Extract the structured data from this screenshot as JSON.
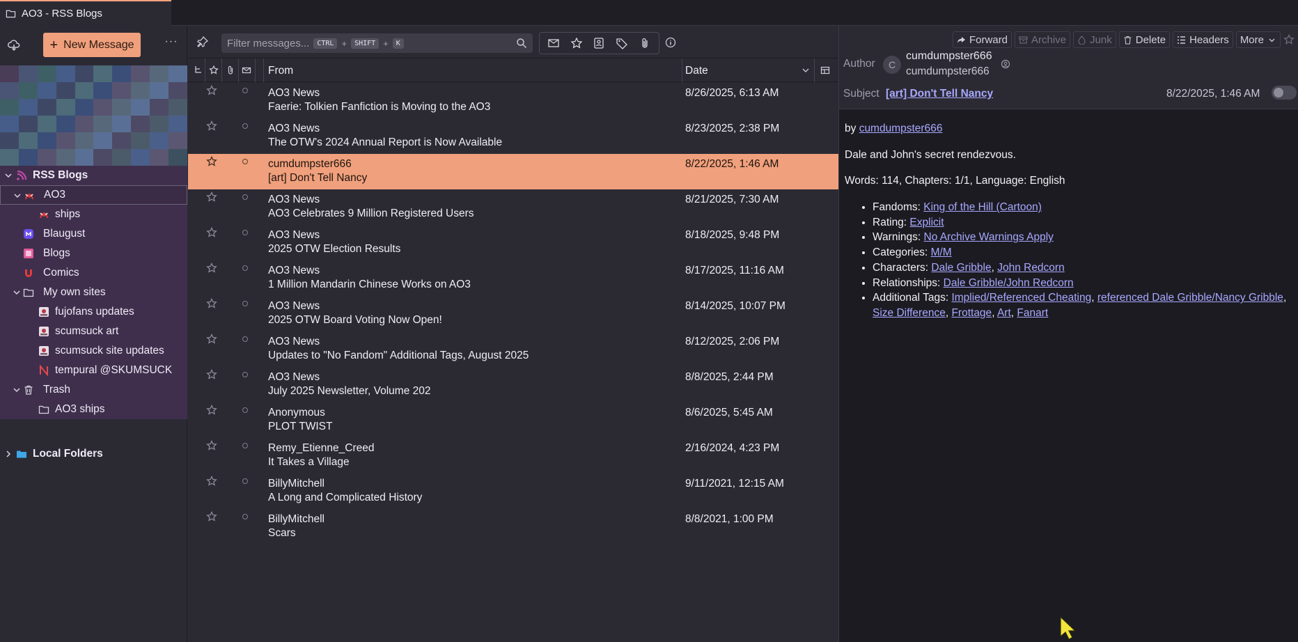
{
  "window": {
    "tab_title": "AO3 - RSS Blogs"
  },
  "sidebar": {
    "new_message": "New Message",
    "more": "···",
    "folders": [
      {
        "label": "RSS Blogs",
        "icon": "rss-icon",
        "bold": true,
        "twisty": "down",
        "indent": 0
      },
      {
        "label": "AO3",
        "icon": "ao3-feed-icon",
        "bold": false,
        "twisty": "down",
        "indent": 1,
        "selected": true
      },
      {
        "label": "ships",
        "icon": "ao3-feed-icon",
        "bold": false,
        "twisty": "",
        "indent": 2
      },
      {
        "label": "Blaugust",
        "icon": "mastodon-feed-icon",
        "bold": false,
        "twisty": "",
        "indent": 1
      },
      {
        "label": "Blogs",
        "icon": "blogs-feed-icon",
        "bold": false,
        "twisty": "",
        "indent": 1
      },
      {
        "label": "Comics",
        "icon": "comics-feed-icon",
        "bold": false,
        "twisty": "",
        "indent": 1
      },
      {
        "label": "My own sites",
        "icon": "folder-icon",
        "bold": false,
        "twisty": "down",
        "indent": 1
      },
      {
        "label": "fujofans updates",
        "icon": "site-feed-icon",
        "bold": false,
        "twisty": "",
        "indent": 2
      },
      {
        "label": "scumsuck art",
        "icon": "site-feed-icon",
        "bold": false,
        "twisty": "",
        "indent": 2
      },
      {
        "label": "scumsuck site updates",
        "icon": "site-feed-icon",
        "bold": false,
        "twisty": "",
        "indent": 2
      },
      {
        "label": "tempural @SKUMSUCK",
        "icon": "tempural-feed-icon",
        "bold": false,
        "twisty": "",
        "indent": 2
      },
      {
        "label": "Trash",
        "icon": "trash-icon",
        "bold": false,
        "twisty": "down",
        "indent": 1
      },
      {
        "label": "AO3 ships",
        "icon": "folder-icon",
        "bold": false,
        "twisty": "",
        "indent": 2
      }
    ],
    "local_folders": "Local Folders"
  },
  "list": {
    "filter_placeholder": "Filter messages...",
    "shortcut": [
      "CTRL",
      "SHIFT",
      "K"
    ],
    "col_from": "From",
    "col_date": "Date",
    "messages": [
      {
        "from": "AO3 News",
        "subject": "Faerie: Tolkien Fanfiction is Moving to the AO3",
        "date": "8/26/2025, 6:13 AM"
      },
      {
        "from": "AO3 News",
        "subject": "The OTW's 2024 Annual Report is Now Available",
        "date": "8/23/2025, 2:38 PM"
      },
      {
        "from": "cumdumpster666",
        "subject": "[art] Don't Tell Nancy",
        "date": "8/22/2025, 1:46 AM",
        "selected": true
      },
      {
        "from": "AO3 News",
        "subject": "AO3 Celebrates 9 Million Registered Users",
        "date": "8/21/2025, 7:30 AM"
      },
      {
        "from": "AO3 News",
        "subject": "2025 OTW Election Results",
        "date": "8/18/2025, 9:48 PM"
      },
      {
        "from": "AO3 News",
        "subject": "1 Million Mandarin Chinese Works on AO3",
        "date": "8/17/2025, 11:16 AM"
      },
      {
        "from": "AO3 News",
        "subject": "2025 OTW Board Voting Now Open!",
        "date": "8/14/2025, 10:07 PM"
      },
      {
        "from": "AO3 News",
        "subject": "Updates to \"No Fandom\" Additional Tags, August 2025",
        "date": "8/12/2025, 2:06 PM"
      },
      {
        "from": "AO3 News",
        "subject": "July 2025 Newsletter, Volume 202",
        "date": "8/8/2025, 2:44 PM"
      },
      {
        "from": "Anonymous",
        "subject": "PLOT TWIST",
        "date": "8/6/2025, 5:45 AM"
      },
      {
        "from": "Remy_Etienne_Creed",
        "subject": "It Takes a Village",
        "date": "2/16/2024, 4:23 PM"
      },
      {
        "from": "BillyMitchell",
        "subject": "A Long and Complicated History",
        "date": "9/11/2021, 12:15 AM"
      },
      {
        "from": "BillyMitchell",
        "subject": "Scars",
        "date": "8/8/2021, 1:00 PM"
      }
    ]
  },
  "reader": {
    "buttons": [
      {
        "label": "Forward",
        "dim": false,
        "icon": "forward-icon"
      },
      {
        "label": "Archive",
        "dim": true,
        "icon": "archive-icon"
      },
      {
        "label": "Junk",
        "dim": true,
        "icon": "junk-icon"
      },
      {
        "label": "Delete",
        "dim": false,
        "icon": "delete-icon"
      },
      {
        "label": "Headers",
        "dim": false,
        "icon": "headers-icon"
      },
      {
        "label": "More",
        "dim": false,
        "icon": "chevron-down-icon"
      }
    ],
    "author_label": "Author",
    "avatar_letter": "C",
    "author_name": "cumdumpster666",
    "author_email": "cumdumpster666",
    "subject_label": "Subject",
    "subject": "[art] Don't Tell Nancy",
    "date": "8/22/2025, 1:46 AM",
    "body": {
      "by_prefix": "by ",
      "by_link": "cumdumpster666",
      "summary": "Dale and John's secret rendezvous.",
      "stats": "Words: 114, Chapters: 1/1, Language: English",
      "meta": [
        {
          "label": "Fandoms: ",
          "links": [
            "King of the Hill (Cartoon)"
          ]
        },
        {
          "label": "Rating: ",
          "links": [
            "Explicit"
          ]
        },
        {
          "label": "Warnings: ",
          "links": [
            "No Archive Warnings Apply"
          ]
        },
        {
          "label": "Categories: ",
          "links": [
            "M/M"
          ]
        },
        {
          "label": "Characters: ",
          "links": [
            "Dale Gribble",
            "John Redcorn"
          ]
        },
        {
          "label": "Relationships: ",
          "links": [
            "Dale Gribble/John Redcorn"
          ]
        },
        {
          "label": "Additional Tags: ",
          "links": [
            "Implied/Referenced Cheating",
            "referenced Dale Gribble/Nancy Gribble",
            "Size Difference",
            "Frottage",
            "Art",
            "Fanart"
          ]
        }
      ]
    }
  },
  "colors": {
    "accent": "#f0a07c",
    "folder_pane_highlight": "#3f2f4d",
    "link": "#a8a8ff"
  }
}
